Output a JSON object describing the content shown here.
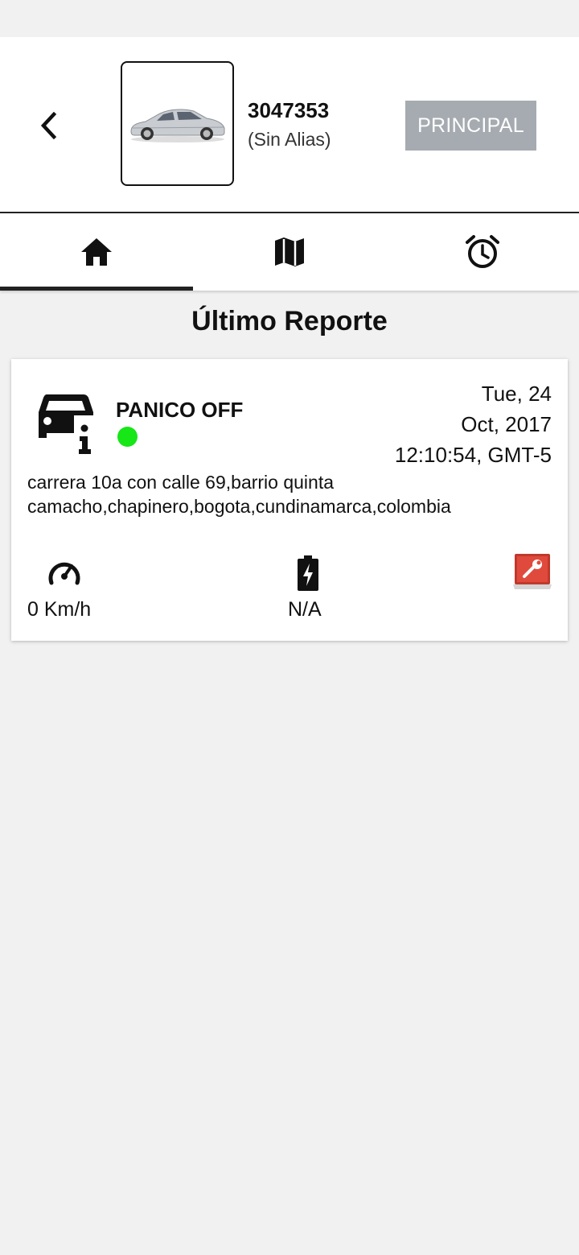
{
  "header": {
    "back_icon": "chevron-left-icon",
    "vehicle_image": "car-photo",
    "plate": "3047353",
    "alias": "(Sin Alias)",
    "principal_label": "PRINCIPAL",
    "principal_color": "#a6abb1"
  },
  "tabs": [
    {
      "icon": "home-icon",
      "active": true
    },
    {
      "icon": "map-icon",
      "active": false
    },
    {
      "icon": "alarm-clock-icon",
      "active": false
    }
  ],
  "section": {
    "title": "Último Reporte"
  },
  "report": {
    "event_icon": "car-info-icon",
    "event_name": "PANICO OFF",
    "status_color": "#17e617",
    "date_line1": "Tue, 24",
    "date_line2": "Oct, 2017",
    "date_line3": "12:10:54, GMT-5",
    "address_line1": "carrera 10a con calle 69,barrio quinta",
    "address_line2": "camacho,chapinero,bogota,cundinamarca,colombia",
    "speed_icon": "speedometer-icon",
    "speed": "0 Km/h",
    "battery_icon": "battery-charging-icon",
    "battery": "N/A",
    "tool_icon": "laptop-wrench-icon"
  }
}
